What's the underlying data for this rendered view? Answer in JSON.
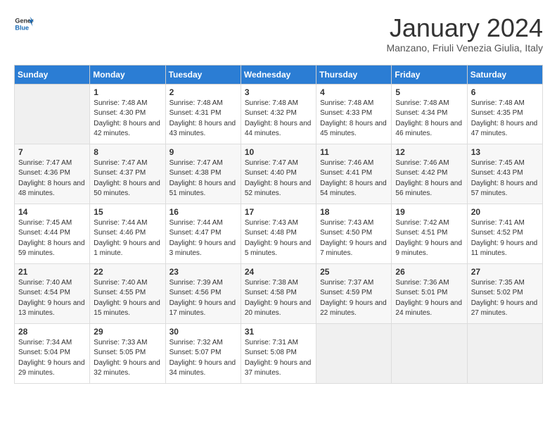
{
  "logo": {
    "general": "General",
    "blue": "Blue"
  },
  "header": {
    "month": "January 2024",
    "location": "Manzano, Friuli Venezia Giulia, Italy"
  },
  "weekdays": [
    "Sunday",
    "Monday",
    "Tuesday",
    "Wednesday",
    "Thursday",
    "Friday",
    "Saturday"
  ],
  "weeks": [
    [
      {
        "day": "",
        "empty": true
      },
      {
        "day": "1",
        "sunrise": "7:48 AM",
        "sunset": "4:30 PM",
        "daylight": "8 hours and 42 minutes."
      },
      {
        "day": "2",
        "sunrise": "7:48 AM",
        "sunset": "4:31 PM",
        "daylight": "8 hours and 43 minutes."
      },
      {
        "day": "3",
        "sunrise": "7:48 AM",
        "sunset": "4:32 PM",
        "daylight": "8 hours and 44 minutes."
      },
      {
        "day": "4",
        "sunrise": "7:48 AM",
        "sunset": "4:33 PM",
        "daylight": "8 hours and 45 minutes."
      },
      {
        "day": "5",
        "sunrise": "7:48 AM",
        "sunset": "4:34 PM",
        "daylight": "8 hours and 46 minutes."
      },
      {
        "day": "6",
        "sunrise": "7:48 AM",
        "sunset": "4:35 PM",
        "daylight": "8 hours and 47 minutes."
      }
    ],
    [
      {
        "day": "7",
        "sunrise": "7:47 AM",
        "sunset": "4:36 PM",
        "daylight": "8 hours and 48 minutes."
      },
      {
        "day": "8",
        "sunrise": "7:47 AM",
        "sunset": "4:37 PM",
        "daylight": "8 hours and 50 minutes."
      },
      {
        "day": "9",
        "sunrise": "7:47 AM",
        "sunset": "4:38 PM",
        "daylight": "8 hours and 51 minutes."
      },
      {
        "day": "10",
        "sunrise": "7:47 AM",
        "sunset": "4:40 PM",
        "daylight": "8 hours and 52 minutes."
      },
      {
        "day": "11",
        "sunrise": "7:46 AM",
        "sunset": "4:41 PM",
        "daylight": "8 hours and 54 minutes."
      },
      {
        "day": "12",
        "sunrise": "7:46 AM",
        "sunset": "4:42 PM",
        "daylight": "8 hours and 56 minutes."
      },
      {
        "day": "13",
        "sunrise": "7:45 AM",
        "sunset": "4:43 PM",
        "daylight": "8 hours and 57 minutes."
      }
    ],
    [
      {
        "day": "14",
        "sunrise": "7:45 AM",
        "sunset": "4:44 PM",
        "daylight": "8 hours and 59 minutes."
      },
      {
        "day": "15",
        "sunrise": "7:44 AM",
        "sunset": "4:46 PM",
        "daylight": "9 hours and 1 minute."
      },
      {
        "day": "16",
        "sunrise": "7:44 AM",
        "sunset": "4:47 PM",
        "daylight": "9 hours and 3 minutes."
      },
      {
        "day": "17",
        "sunrise": "7:43 AM",
        "sunset": "4:48 PM",
        "daylight": "9 hours and 5 minutes."
      },
      {
        "day": "18",
        "sunrise": "7:43 AM",
        "sunset": "4:50 PM",
        "daylight": "9 hours and 7 minutes."
      },
      {
        "day": "19",
        "sunrise": "7:42 AM",
        "sunset": "4:51 PM",
        "daylight": "9 hours and 9 minutes."
      },
      {
        "day": "20",
        "sunrise": "7:41 AM",
        "sunset": "4:52 PM",
        "daylight": "9 hours and 11 minutes."
      }
    ],
    [
      {
        "day": "21",
        "sunrise": "7:40 AM",
        "sunset": "4:54 PM",
        "daylight": "9 hours and 13 minutes."
      },
      {
        "day": "22",
        "sunrise": "7:40 AM",
        "sunset": "4:55 PM",
        "daylight": "9 hours and 15 minutes."
      },
      {
        "day": "23",
        "sunrise": "7:39 AM",
        "sunset": "4:56 PM",
        "daylight": "9 hours and 17 minutes."
      },
      {
        "day": "24",
        "sunrise": "7:38 AM",
        "sunset": "4:58 PM",
        "daylight": "9 hours and 20 minutes."
      },
      {
        "day": "25",
        "sunrise": "7:37 AM",
        "sunset": "4:59 PM",
        "daylight": "9 hours and 22 minutes."
      },
      {
        "day": "26",
        "sunrise": "7:36 AM",
        "sunset": "5:01 PM",
        "daylight": "9 hours and 24 minutes."
      },
      {
        "day": "27",
        "sunrise": "7:35 AM",
        "sunset": "5:02 PM",
        "daylight": "9 hours and 27 minutes."
      }
    ],
    [
      {
        "day": "28",
        "sunrise": "7:34 AM",
        "sunset": "5:04 PM",
        "daylight": "9 hours and 29 minutes."
      },
      {
        "day": "29",
        "sunrise": "7:33 AM",
        "sunset": "5:05 PM",
        "daylight": "9 hours and 32 minutes."
      },
      {
        "day": "30",
        "sunrise": "7:32 AM",
        "sunset": "5:07 PM",
        "daylight": "9 hours and 34 minutes."
      },
      {
        "day": "31",
        "sunrise": "7:31 AM",
        "sunset": "5:08 PM",
        "daylight": "9 hours and 37 minutes."
      },
      {
        "day": "",
        "empty": true
      },
      {
        "day": "",
        "empty": true
      },
      {
        "day": "",
        "empty": true
      }
    ]
  ]
}
